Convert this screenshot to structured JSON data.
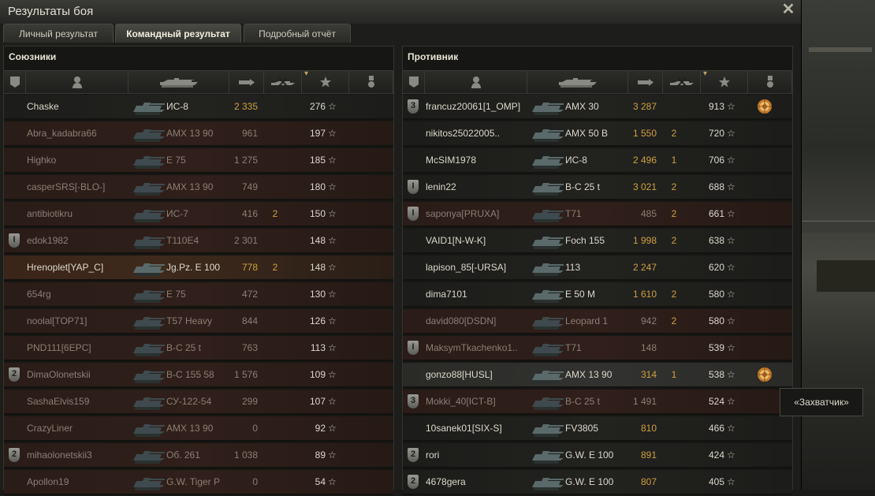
{
  "window": {
    "title": "Результаты боя"
  },
  "tabs": [
    {
      "label": "Личный результат",
      "active": false
    },
    {
      "label": "Командный результат",
      "active": true
    },
    {
      "label": "Подробный отчёт",
      "active": false
    }
  ],
  "allies": {
    "title": "Союзники",
    "rows": [
      {
        "name": "Chaske",
        "tank": "ИС-8",
        "dmg": "2 335",
        "kills": "",
        "xp": "276",
        "badge": "",
        "state": "alive",
        "medal": false
      },
      {
        "name": "Abra_kadabra66",
        "tank": "AMX 13 90",
        "dmg": "961",
        "kills": "",
        "xp": "197",
        "badge": "",
        "state": "dead",
        "medal": false
      },
      {
        "name": "Highko",
        "tank": "E 75",
        "dmg": "1 275",
        "kills": "",
        "xp": "185",
        "badge": "",
        "state": "dead",
        "medal": false
      },
      {
        "name": "casperSRS[-BLO-]",
        "tank": "AMX 13 90",
        "dmg": "749",
        "kills": "",
        "xp": "180",
        "badge": "",
        "state": "dead",
        "medal": false
      },
      {
        "name": "antibiotikru",
        "tank": "ИС-7",
        "dmg": "416",
        "kills": "2",
        "xp": "150",
        "badge": "",
        "state": "dead",
        "medal": false
      },
      {
        "name": "edok1982",
        "tank": "T110E4",
        "dmg": "2 301",
        "kills": "",
        "xp": "148",
        "badge": "I",
        "state": "dead",
        "medal": false
      },
      {
        "name": "Hrenoplet[YAP_C]",
        "tank": "Jg.Pz. E 100",
        "dmg": "778",
        "kills": "2",
        "xp": "148",
        "badge": "",
        "state": "highlight",
        "medal": false
      },
      {
        "name": "654rg",
        "tank": "E 75",
        "dmg": "472",
        "kills": "",
        "xp": "130",
        "badge": "",
        "state": "dead",
        "medal": false
      },
      {
        "name": "noolal[TOP71]",
        "tank": "T57 Heavy",
        "dmg": "844",
        "kills": "",
        "xp": "126",
        "badge": "",
        "state": "dead",
        "medal": false
      },
      {
        "name": "PND111[6EPC]",
        "tank": "B-C 25 t",
        "dmg": "763",
        "kills": "",
        "xp": "113",
        "badge": "",
        "state": "dead",
        "medal": false
      },
      {
        "name": "DimaOlonetskii",
        "tank": "B-C 155 58",
        "dmg": "1 576",
        "kills": "",
        "xp": "109",
        "badge": "2",
        "state": "dead",
        "medal": false
      },
      {
        "name": "SashaElvis159",
        "tank": "СУ-122-54",
        "dmg": "299",
        "kills": "",
        "xp": "107",
        "badge": "",
        "state": "dead",
        "medal": false
      },
      {
        "name": "CrazyLiner",
        "tank": "AMX 13 90",
        "dmg": "0",
        "kills": "",
        "xp": "92",
        "badge": "",
        "state": "dead",
        "medal": false
      },
      {
        "name": "mihaolonetskii3",
        "tank": "Об. 261",
        "dmg": "1 038",
        "kills": "",
        "xp": "89",
        "badge": "2",
        "state": "dead",
        "medal": false
      },
      {
        "name": "Apollon19",
        "tank": "G.W. Tiger P",
        "dmg": "0",
        "kills": "",
        "xp": "54",
        "badge": "",
        "state": "dead",
        "medal": false
      }
    ]
  },
  "enemies": {
    "title": "Противник",
    "rows": [
      {
        "name": "francuz20061[1_OMP]",
        "tank": "AMX 30",
        "dmg": "3 287",
        "kills": "",
        "xp": "913",
        "badge": "3",
        "state": "alive",
        "medal": true
      },
      {
        "name": "nikitos25022005..",
        "tank": "AMX 50 B",
        "dmg": "1 550",
        "kills": "2",
        "xp": "720",
        "badge": "",
        "state": "alive",
        "medal": false
      },
      {
        "name": "McSIM1978",
        "tank": "ИС-8",
        "dmg": "2 496",
        "kills": "1",
        "xp": "706",
        "badge": "",
        "state": "alive",
        "medal": false
      },
      {
        "name": "lenin22",
        "tank": "B-C 25 t",
        "dmg": "3 021",
        "kills": "2",
        "xp": "688",
        "badge": "I",
        "state": "alive",
        "medal": false
      },
      {
        "name": "saponya[PRUXA]",
        "tank": "T71",
        "dmg": "485",
        "kills": "2",
        "xp": "661",
        "badge": "I",
        "state": "dead",
        "medal": false
      },
      {
        "name": "VAID1[N-W-K]",
        "tank": "Foch 155",
        "dmg": "1 998",
        "kills": "2",
        "xp": "638",
        "badge": "",
        "state": "alive",
        "medal": false
      },
      {
        "name": "lapison_85[-URSA]",
        "tank": "113",
        "dmg": "2 247",
        "kills": "",
        "xp": "620",
        "badge": "",
        "state": "alive",
        "medal": false
      },
      {
        "name": "dima7101",
        "tank": "E 50 M",
        "dmg": "1 610",
        "kills": "2",
        "xp": "580",
        "badge": "",
        "state": "alive",
        "medal": false
      },
      {
        "name": "david080[DSDN]",
        "tank": "Leopard 1",
        "dmg": "942",
        "kills": "2",
        "xp": "580",
        "badge": "",
        "state": "dead",
        "medal": false
      },
      {
        "name": "MaksymTkachenko1..",
        "tank": "T71",
        "dmg": "148",
        "kills": "",
        "xp": "539",
        "badge": "I",
        "state": "dead",
        "medal": false
      },
      {
        "name": "gonzo88[HUSL]",
        "tank": "AMX 13 90",
        "dmg": "314",
        "kills": "1",
        "xp": "538",
        "badge": "",
        "state": "hover",
        "medal": true
      },
      {
        "name": "Mokki_40[ICT-B]",
        "tank": "B-C 25 t",
        "dmg": "1 491",
        "kills": "",
        "xp": "524",
        "badge": "3",
        "state": "dead",
        "medal": false
      },
      {
        "name": "10sanek01[SIX-S]",
        "tank": "FV3805",
        "dmg": "810",
        "kills": "",
        "xp": "466",
        "badge": "",
        "state": "alive",
        "medal": false
      },
      {
        "name": "rori",
        "tank": "G.W. E 100",
        "dmg": "891",
        "kills": "",
        "xp": "424",
        "badge": "2",
        "state": "alive",
        "medal": false
      },
      {
        "name": "4678gera",
        "tank": "G.W. E 100",
        "dmg": "807",
        "kills": "",
        "xp": "405",
        "badge": "2",
        "state": "alive",
        "medal": false
      }
    ]
  },
  "tooltip": {
    "text": "«Захватчик»"
  },
  "icons": {
    "star": "☆",
    "close": "✕",
    "sort": "▾"
  },
  "colors": {
    "damage": "#d0a040",
    "text": "#dcd8cc",
    "dead_text": "#8c7f74"
  }
}
